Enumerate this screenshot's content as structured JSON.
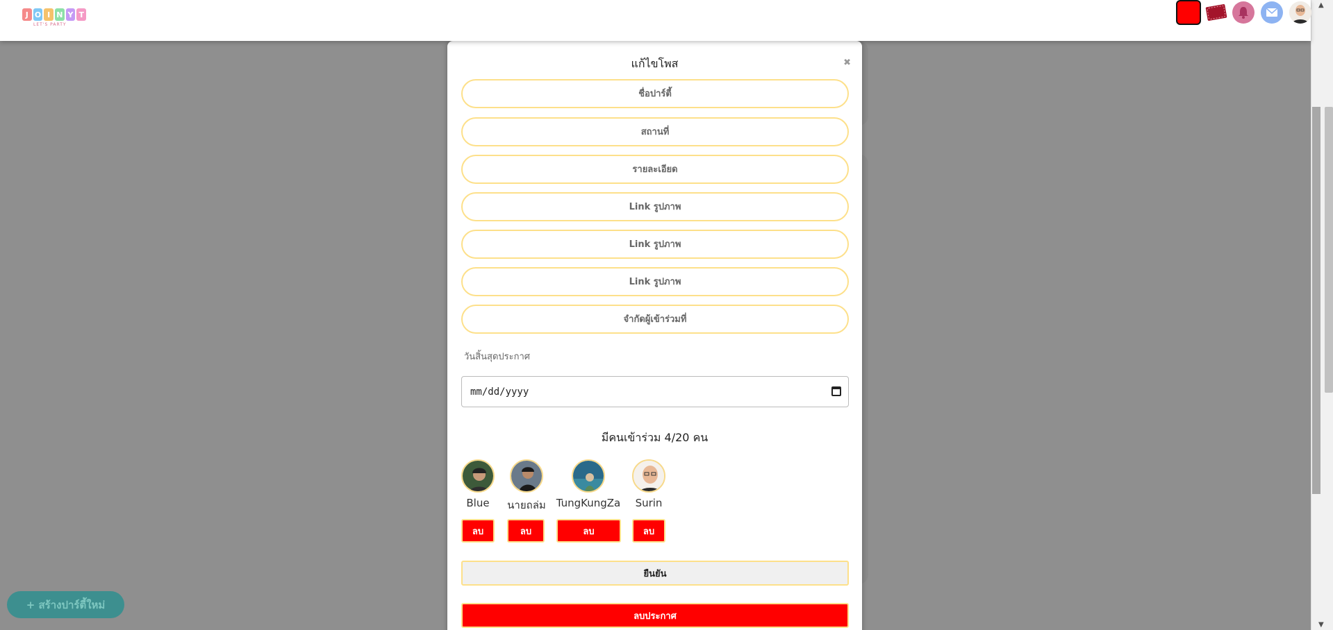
{
  "navbar": {
    "logo_letters": [
      "J",
      "O",
      "I",
      "N",
      "Y",
      "T"
    ],
    "logo_colors": [
      "#f58a8a",
      "#7fc8f5",
      "#f5c26b",
      "#8de0a8",
      "#c59af5",
      "#f59ac5"
    ],
    "logo_tagline": "LET'S PARTY",
    "icons": [
      "red-square-icon",
      "ticket-icon",
      "bell-icon",
      "mail-icon",
      "user-avatar"
    ]
  },
  "modal": {
    "title": "แก้ไขโพส",
    "close_label": "✖",
    "fields": {
      "party_name": "ชื่อปาร์ตี้",
      "location": "สถานที่",
      "details": "รายละเอียด",
      "image_link_1": "Link รูปภาพ",
      "image_link_2": "Link รูปภาพ",
      "image_link_3": "Link รูปภาพ",
      "max_participants": "จำกัดผู้เข้าร่วมที่"
    },
    "date_label": "วันสิ้นสุดประกาศ",
    "date_value": "mm/dd/yyyy",
    "joined_text": "มีคนเข้าร่วม 4/20 คน",
    "members": [
      {
        "name": "Blue",
        "remove_label": "ลบ"
      },
      {
        "name": "นายถล่ม",
        "remove_label": "ลบ"
      },
      {
        "name": "TungKungZa",
        "remove_label": "ลบ"
      },
      {
        "name": "Surin",
        "remove_label": "ลบ"
      }
    ],
    "confirm_label": "ยืนยัน",
    "delete_post_label": "ลบประกาศ"
  },
  "create_button_label": "+ สร้างปาร์ตี้ใหม่",
  "colors": {
    "accent_red": "#ff0000",
    "field_border": "#fde08a",
    "overlay": "#8f8f8f"
  }
}
